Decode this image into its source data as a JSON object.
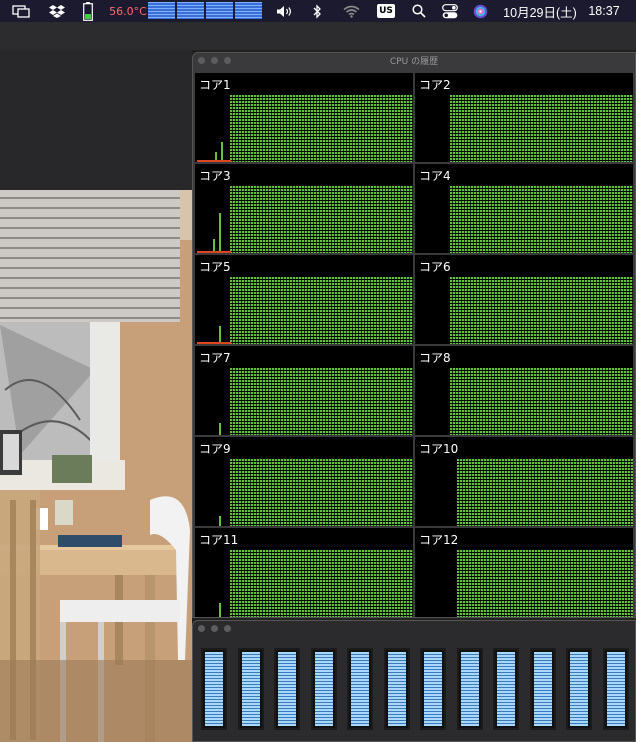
{
  "menubar": {
    "temperature": "56.0°C",
    "input_source": "US",
    "date": "10月29日(土)",
    "time": "18:37",
    "icons": [
      "display-icon",
      "dropbox-icon",
      "battery-icon",
      "cpu-meter-icon",
      "volume-icon",
      "bluetooth-icon",
      "wifi-icon",
      "input-source-icon",
      "search-icon",
      "control-center-icon",
      "siri-icon"
    ]
  },
  "cpu_history": {
    "title": "CPU の履歴",
    "cores": [
      {
        "label": "コア1",
        "level": 0.03
      },
      {
        "label": "コア2",
        "level": 0.01
      },
      {
        "label": "コア3",
        "level": 0.04
      },
      {
        "label": "コア4",
        "level": 0.01
      },
      {
        "label": "コア5",
        "level": 0.03
      },
      {
        "label": "コア6",
        "level": 0.01
      },
      {
        "label": "コア7",
        "level": 0.02
      },
      {
        "label": "コア8",
        "level": 0.01
      },
      {
        "label": "コア9",
        "level": 0.02
      },
      {
        "label": "コア10",
        "level": 0.01
      },
      {
        "label": "コア11",
        "level": 0.02
      },
      {
        "label": "コア12",
        "level": 0.01
      }
    ]
  },
  "cpu_usage": {
    "core_levels": [
      1,
      1,
      1,
      1,
      1,
      1,
      1,
      1,
      1,
      1,
      1,
      1
    ]
  }
}
